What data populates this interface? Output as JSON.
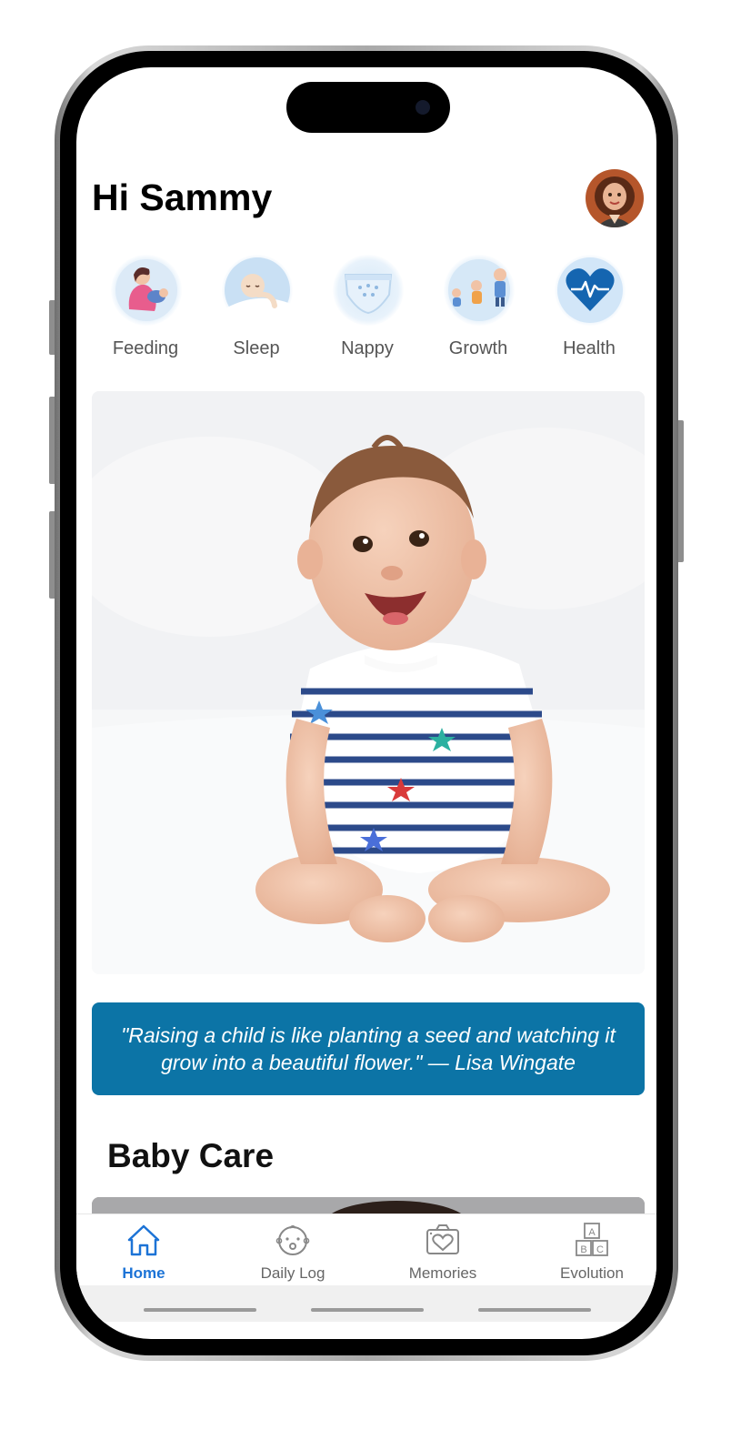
{
  "header": {
    "greeting": "Hi Sammy",
    "avatar_icon": "user-avatar-icon"
  },
  "categories": [
    {
      "label": "Feeding",
      "icon": "feeding-icon"
    },
    {
      "label": "Sleep",
      "icon": "sleep-icon"
    },
    {
      "label": "Nappy",
      "icon": "nappy-icon"
    },
    {
      "label": "Growth",
      "icon": "growth-icon"
    },
    {
      "label": "Health",
      "icon": "heart-pulse-icon"
    }
  ],
  "hero": {
    "image": "smiling-baby-photo"
  },
  "quote": {
    "text": "\"Raising a child is like planting a seed and watching it grow into a beautiful flower.\" — Lisa Wingate"
  },
  "baby_care": {
    "title": "Baby Care"
  },
  "tabs": [
    {
      "label": "Home",
      "icon": "home-icon",
      "active": true
    },
    {
      "label": "Daily Log",
      "icon": "baby-face-icon",
      "active": false
    },
    {
      "label": "Memories",
      "icon": "camera-heart-icon",
      "active": false
    },
    {
      "label": "Evolution",
      "icon": "abc-blocks-icon",
      "active": false
    }
  ],
  "colors": {
    "accent": "#1c73d6",
    "quote_bg": "#0c74a6",
    "heart": "#1565b0"
  }
}
